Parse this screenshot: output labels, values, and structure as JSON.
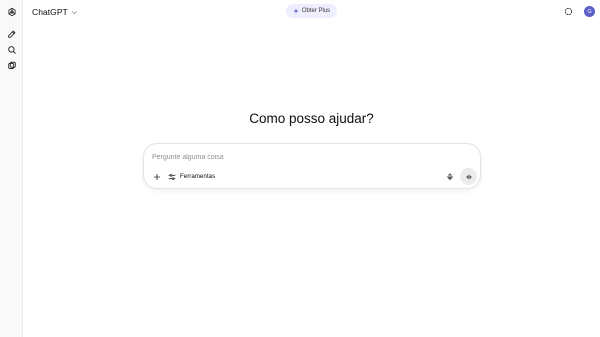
{
  "header": {
    "model_name": "ChatGPT",
    "upgrade_label": "Obter Plus",
    "avatar_initial": "G"
  },
  "main": {
    "headline": "Como posso ajudar?"
  },
  "composer": {
    "placeholder": "Pergunte alguma coisa",
    "value": "",
    "tools_label": "Ferramentas"
  },
  "sidebar": {
    "icons": [
      "openai-logo-icon",
      "new-chat-icon",
      "search-icon",
      "library-icon"
    ]
  },
  "colors": {
    "accent": "#5b5fc7",
    "upgrade_pill_bg": "#eeeeff",
    "rail_bg": "#f9f9f9"
  }
}
